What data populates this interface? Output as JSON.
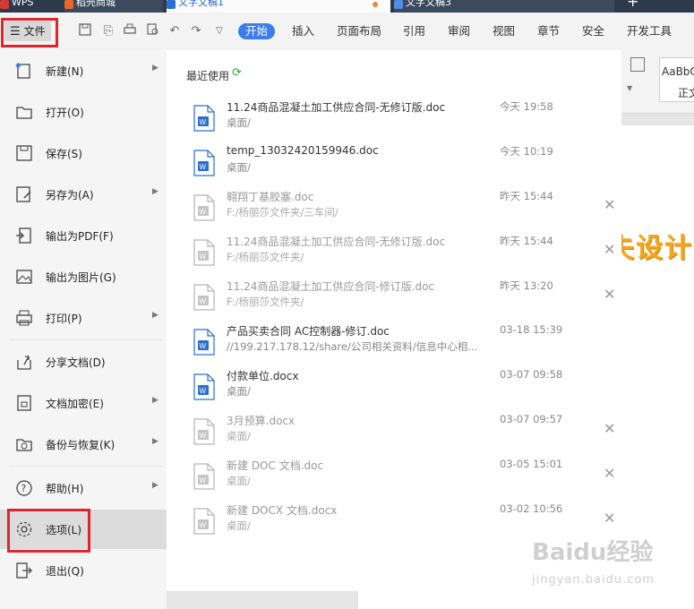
{
  "tabs": {
    "wps": "WPS",
    "store": "稻壳商城",
    "doc1": "文字文稿1",
    "doc3": "文字文稿3",
    "new": "+"
  },
  "toolbar": {
    "file_label": "文件",
    "menu_tabs": [
      "开始",
      "插入",
      "页面布局",
      "引用",
      "审阅",
      "视图",
      "章节",
      "安全",
      "开发工具"
    ],
    "active_tab": "开始",
    "style_sample": "AaBbC",
    "style_name": "正文"
  },
  "file_menu": {
    "items": [
      {
        "label": "新建(N)",
        "icon": "new-doc-icon",
        "submenu": true
      },
      {
        "label": "打开(O)",
        "icon": "folder-open-icon",
        "submenu": false
      },
      {
        "label": "保存(S)",
        "icon": "save-icon",
        "submenu": false
      },
      {
        "label": "另存为(A)",
        "icon": "save-as-icon",
        "submenu": true
      },
      {
        "label": "输出为PDF(F)",
        "icon": "export-pdf-icon",
        "submenu": false
      },
      {
        "label": "输出为图片(G)",
        "icon": "export-image-icon",
        "submenu": false
      },
      {
        "label": "打印(P)",
        "icon": "print-icon",
        "submenu": true
      },
      {
        "label": "分享文档(D)",
        "icon": "share-icon",
        "submenu": false
      },
      {
        "label": "文档加密(E)",
        "icon": "encrypt-icon",
        "submenu": true
      },
      {
        "label": "备份与恢复(K)",
        "icon": "backup-icon",
        "submenu": true
      },
      {
        "label": "帮助(H)",
        "icon": "help-icon",
        "submenu": true
      },
      {
        "label": "选项(L)",
        "icon": "gear-icon",
        "submenu": false
      },
      {
        "label": "退出(Q)",
        "icon": "exit-icon",
        "submenu": false
      }
    ]
  },
  "recent": {
    "title": "最近使用",
    "files": [
      {
        "name": "11.24商品混凝土加工供应合同-无修订版.doc",
        "path": "桌面/",
        "time": "今天 19:58",
        "available": true,
        "removable": false
      },
      {
        "name": "temp_13032420159946.doc",
        "path": "桌面/",
        "time": "今天 10:19",
        "available": true,
        "removable": false
      },
      {
        "name": "翱翔丁基胶塞.doc",
        "path": "F:/杨丽莎文件夹/三车间/",
        "time": "昨天 15:44",
        "available": false,
        "removable": true
      },
      {
        "name": "11.24商品混凝土加工供应合同-无修订版.doc",
        "path": "F:/杨丽莎文件夹/",
        "time": "昨天 15:44",
        "available": false,
        "removable": true
      },
      {
        "name": "11.24商品混凝土加工供应合同-修订版.doc",
        "path": "F:/杨丽莎文件夹/",
        "time": "昨天 13:20",
        "available": false,
        "removable": true
      },
      {
        "name": "产品买卖合同 AC控制器-修订.doc",
        "path": "//199.217.178.12/share/公司相关资料/信息中心相...",
        "time": "03-18 15:39",
        "available": true,
        "removable": false
      },
      {
        "name": "付款单位.docx",
        "path": "桌面/",
        "time": "03-07 09:58",
        "available": true,
        "removable": false
      },
      {
        "name": "3月预算.docx",
        "path": "桌面/",
        "time": "03-07 09:57",
        "available": false,
        "removable": true
      },
      {
        "name": "新建 DOC 文档.doc",
        "path": "桌面/",
        "time": "03-05 15:01",
        "available": false,
        "removable": true
      },
      {
        "name": "新建 DOCX 文档.docx",
        "path": "桌面/",
        "time": "03-02 10:56",
        "available": false,
        "removable": true
      }
    ]
  },
  "document": {
    "wordart": "失设计"
  },
  "watermark": {
    "brand": "Baidu经验",
    "url": "jingyan.baidu.com"
  },
  "colors": {
    "accent": "#3b7cf0",
    "highlight": "#e0232c",
    "word_blue": "#2b6ed0"
  }
}
